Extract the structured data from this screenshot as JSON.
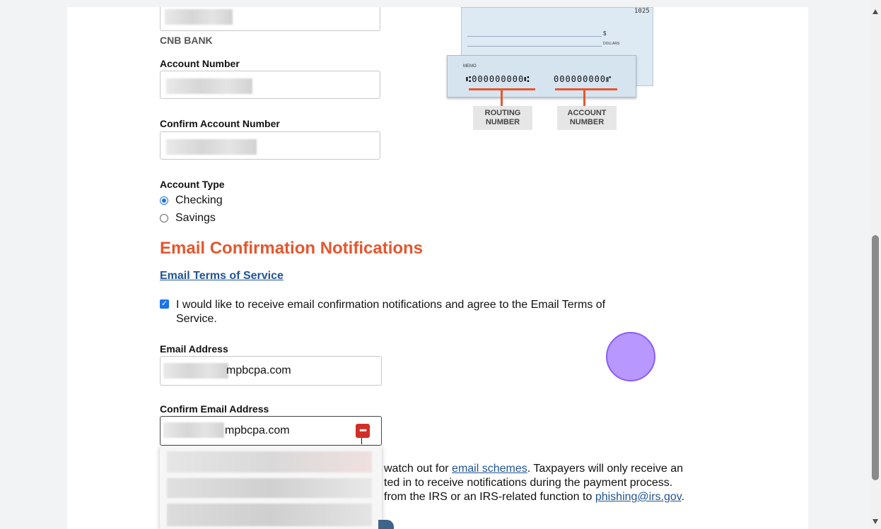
{
  "bank_name": "CNB BANK",
  "check_image": {
    "check_number": "1025",
    "routing_digits": "⑆000000000⑆",
    "account_digits": "000000000⑈",
    "routing_label_1": "ROUTING",
    "routing_label_2": "NUMBER",
    "account_label_1": "ACCOUNT",
    "account_label_2": "NUMBER",
    "memo": "MEMO",
    "dollar_sign": "$",
    "dollars": "DOLLARS"
  },
  "account_number": {
    "label": "Account Number"
  },
  "confirm_account_number": {
    "label": "Confirm Account Number"
  },
  "account_type": {
    "label": "Account Type",
    "options": [
      "Checking",
      "Savings"
    ],
    "selected": "Checking"
  },
  "email_section": {
    "title": "Email Confirmation Notifications",
    "terms_link": "Email Terms of Service",
    "consent_text": "I would like to receive email confirmation notifications and agree to the Email Terms of Service.",
    "email_label": "Email Address",
    "email_value_visible": "mpbcpa.com",
    "confirm_label": "Confirm Email Address",
    "confirm_value_visible": "mpbcpa.com"
  },
  "info": {
    "line1_pre": "watch out for ",
    "line1_link": "email schemes",
    "line1_post": ". Taxpayers will only receive an",
    "line2": "ted in to receive notifications during the payment process.",
    "line3_pre": "from the IRS or an IRS-related function to ",
    "line3_link": "phishing@irs.gov",
    "line3_post": "."
  },
  "colors": {
    "accent_heading": "#e4572e",
    "link": "#205493",
    "radio_checkbox": "#1a73e8",
    "password_manager_icon": "#d32d27"
  }
}
